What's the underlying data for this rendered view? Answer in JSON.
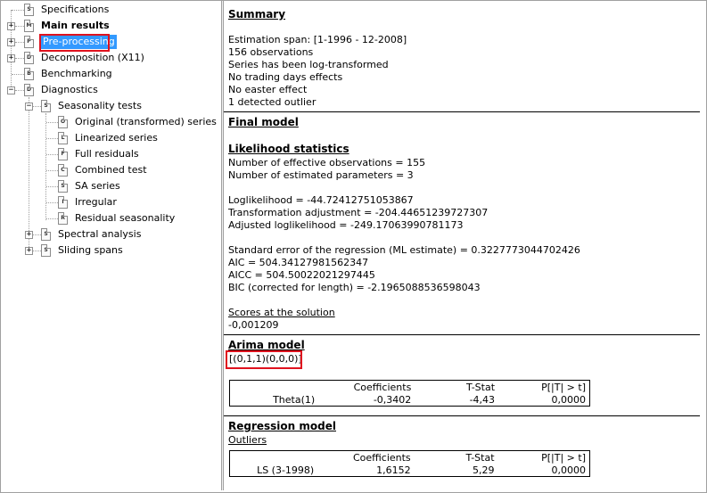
{
  "tree": {
    "items": [
      {
        "label": "Specifications",
        "icon": "S"
      },
      {
        "label": "Main results",
        "icon": "M"
      },
      {
        "label": "Pre-processing",
        "icon": "P"
      },
      {
        "label": "Decomposition (X11)",
        "icon": "D"
      },
      {
        "label": "Benchmarking",
        "icon": "B"
      },
      {
        "label": "Diagnostics",
        "icon": "D"
      },
      {
        "label": "Seasonality tests",
        "icon": "S"
      },
      {
        "label": "Original (transformed) series",
        "icon": "O"
      },
      {
        "label": "Linearized series",
        "icon": "L"
      },
      {
        "label": "Full residuals",
        "icon": "F"
      },
      {
        "label": "Combined test",
        "icon": "C"
      },
      {
        "label": "SA series",
        "icon": "S"
      },
      {
        "label": "Irregular",
        "icon": "I"
      },
      {
        "label": "Residual seasonality",
        "icon": "R"
      },
      {
        "label": "Spectral analysis",
        "icon": "S"
      },
      {
        "label": "Sliding spans",
        "icon": "S"
      }
    ]
  },
  "summary": {
    "title": "Summary",
    "lines": [
      "Estimation span: [1-1996 - 12-2008]",
      "156 observations",
      "Series has been log-transformed",
      "No trading days effects",
      "No easter effect",
      "1 detected outlier"
    ]
  },
  "final_model": {
    "title": "Final model"
  },
  "likelihood": {
    "title": "Likelihood statistics",
    "lines": [
      "Number of effective observations = 155",
      "Number of estimated parameters = 3",
      "Loglikelihood = -44.72412751053867",
      "Transformation adjustment = -204.44651239727307",
      "Adjusted loglikelihood = -249.17063990781173",
      "Standard error of the regression (ML estimate) = 0.3227773044702426",
      "AIC = 504.34127981562347",
      "AICC = 504.50022021297445",
      "BIC (corrected for length) = -2.1965088536598043"
    ],
    "scores_title": "Scores at the solution",
    "scores_value": "-0,001209"
  },
  "arima": {
    "title": "Arima model",
    "spec": "[(0,1,1)(0,0,0)]",
    "headers": [
      "",
      "Coefficients",
      "T-Stat",
      "P[|T| > t]"
    ],
    "row": [
      "Theta(1)",
      "-0,3402",
      "-4,43",
      "0,0000"
    ]
  },
  "regression": {
    "title": "Regression model",
    "subtitle": "Outliers",
    "headers": [
      "",
      "Coefficients",
      "T-Stat",
      "P[|T| > t]"
    ],
    "row": [
      "LS (3-1998)",
      "1,6152",
      "5,29",
      "0,0000"
    ]
  },
  "colors": {
    "selection": "#3399ff",
    "highlight_box": "#e0121e"
  }
}
